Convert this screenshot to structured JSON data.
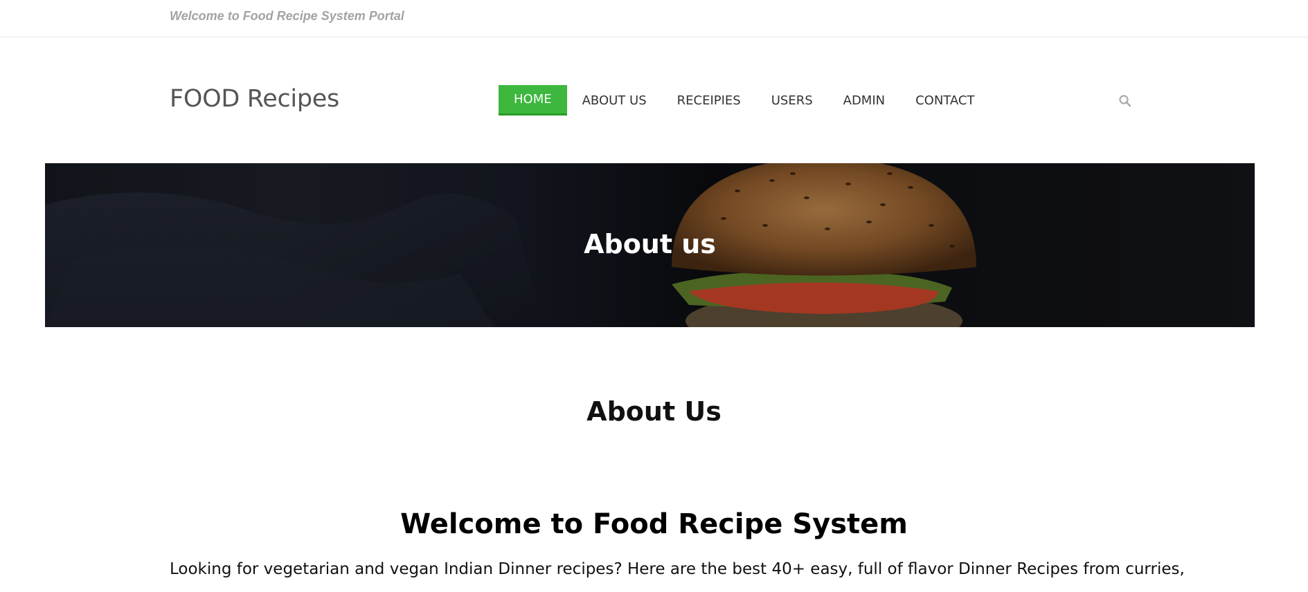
{
  "topbar": {
    "welcome_text": "Welcome to Food Recipe System Portal"
  },
  "header": {
    "logo": "FOOD Recipes",
    "nav": [
      {
        "label": "HOME",
        "active": true
      },
      {
        "label": "ABOUT US",
        "active": false
      },
      {
        "label": "RECEIPIES",
        "active": false
      },
      {
        "label": "USERS",
        "active": false
      },
      {
        "label": "ADMIN",
        "active": false
      },
      {
        "label": "CONTACT",
        "active": false
      }
    ],
    "search_icon": "search-icon"
  },
  "hero": {
    "title": "About us"
  },
  "main": {
    "section_title": "About Us",
    "welcome_title": "Welcome to Food Recipe System",
    "intro": "Looking for vegetarian and vegan Indian Dinner recipes? Here are the best 40+ easy, full of flavor Dinner Recipes from curries,"
  },
  "colors": {
    "accent": "#3db73d",
    "accent_dark": "#279c27",
    "muted_text": "#a3a3a3"
  }
}
